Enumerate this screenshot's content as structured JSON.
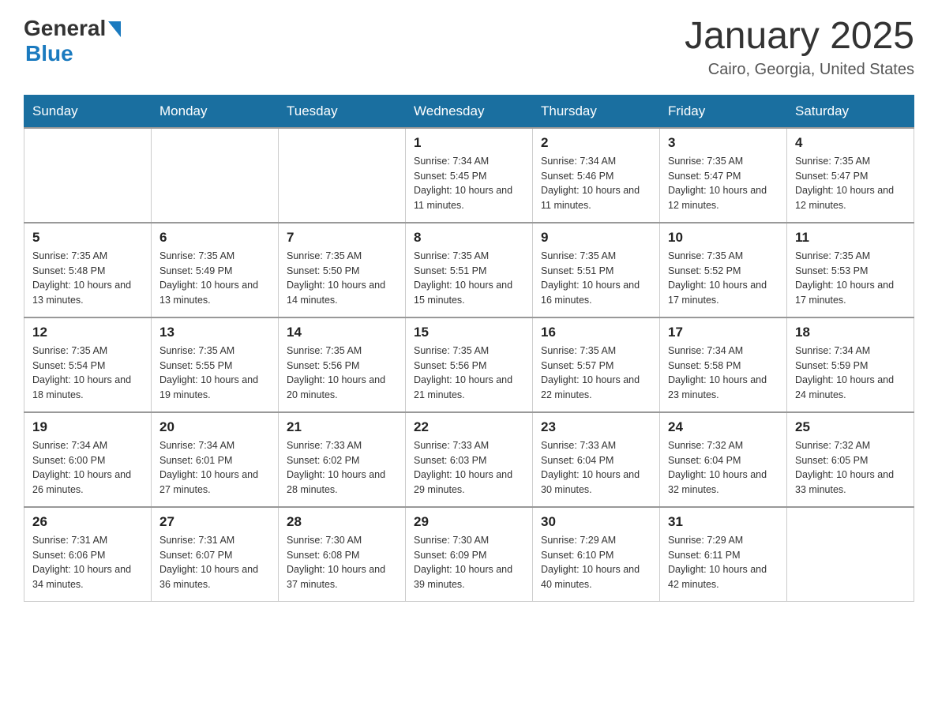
{
  "header": {
    "logo_general": "General",
    "logo_blue": "Blue",
    "month_title": "January 2025",
    "location": "Cairo, Georgia, United States"
  },
  "days_of_week": [
    "Sunday",
    "Monday",
    "Tuesday",
    "Wednesday",
    "Thursday",
    "Friday",
    "Saturday"
  ],
  "weeks": [
    [
      {
        "day": "",
        "sunrise": "",
        "sunset": "",
        "daylight": ""
      },
      {
        "day": "",
        "sunrise": "",
        "sunset": "",
        "daylight": ""
      },
      {
        "day": "",
        "sunrise": "",
        "sunset": "",
        "daylight": ""
      },
      {
        "day": "1",
        "sunrise": "Sunrise: 7:34 AM",
        "sunset": "Sunset: 5:45 PM",
        "daylight": "Daylight: 10 hours and 11 minutes."
      },
      {
        "day": "2",
        "sunrise": "Sunrise: 7:34 AM",
        "sunset": "Sunset: 5:46 PM",
        "daylight": "Daylight: 10 hours and 11 minutes."
      },
      {
        "day": "3",
        "sunrise": "Sunrise: 7:35 AM",
        "sunset": "Sunset: 5:47 PM",
        "daylight": "Daylight: 10 hours and 12 minutes."
      },
      {
        "day": "4",
        "sunrise": "Sunrise: 7:35 AM",
        "sunset": "Sunset: 5:47 PM",
        "daylight": "Daylight: 10 hours and 12 minutes."
      }
    ],
    [
      {
        "day": "5",
        "sunrise": "Sunrise: 7:35 AM",
        "sunset": "Sunset: 5:48 PM",
        "daylight": "Daylight: 10 hours and 13 minutes."
      },
      {
        "day": "6",
        "sunrise": "Sunrise: 7:35 AM",
        "sunset": "Sunset: 5:49 PM",
        "daylight": "Daylight: 10 hours and 13 minutes."
      },
      {
        "day": "7",
        "sunrise": "Sunrise: 7:35 AM",
        "sunset": "Sunset: 5:50 PM",
        "daylight": "Daylight: 10 hours and 14 minutes."
      },
      {
        "day": "8",
        "sunrise": "Sunrise: 7:35 AM",
        "sunset": "Sunset: 5:51 PM",
        "daylight": "Daylight: 10 hours and 15 minutes."
      },
      {
        "day": "9",
        "sunrise": "Sunrise: 7:35 AM",
        "sunset": "Sunset: 5:51 PM",
        "daylight": "Daylight: 10 hours and 16 minutes."
      },
      {
        "day": "10",
        "sunrise": "Sunrise: 7:35 AM",
        "sunset": "Sunset: 5:52 PM",
        "daylight": "Daylight: 10 hours and 17 minutes."
      },
      {
        "day": "11",
        "sunrise": "Sunrise: 7:35 AM",
        "sunset": "Sunset: 5:53 PM",
        "daylight": "Daylight: 10 hours and 17 minutes."
      }
    ],
    [
      {
        "day": "12",
        "sunrise": "Sunrise: 7:35 AM",
        "sunset": "Sunset: 5:54 PM",
        "daylight": "Daylight: 10 hours and 18 minutes."
      },
      {
        "day": "13",
        "sunrise": "Sunrise: 7:35 AM",
        "sunset": "Sunset: 5:55 PM",
        "daylight": "Daylight: 10 hours and 19 minutes."
      },
      {
        "day": "14",
        "sunrise": "Sunrise: 7:35 AM",
        "sunset": "Sunset: 5:56 PM",
        "daylight": "Daylight: 10 hours and 20 minutes."
      },
      {
        "day": "15",
        "sunrise": "Sunrise: 7:35 AM",
        "sunset": "Sunset: 5:56 PM",
        "daylight": "Daylight: 10 hours and 21 minutes."
      },
      {
        "day": "16",
        "sunrise": "Sunrise: 7:35 AM",
        "sunset": "Sunset: 5:57 PM",
        "daylight": "Daylight: 10 hours and 22 minutes."
      },
      {
        "day": "17",
        "sunrise": "Sunrise: 7:34 AM",
        "sunset": "Sunset: 5:58 PM",
        "daylight": "Daylight: 10 hours and 23 minutes."
      },
      {
        "day": "18",
        "sunrise": "Sunrise: 7:34 AM",
        "sunset": "Sunset: 5:59 PM",
        "daylight": "Daylight: 10 hours and 24 minutes."
      }
    ],
    [
      {
        "day": "19",
        "sunrise": "Sunrise: 7:34 AM",
        "sunset": "Sunset: 6:00 PM",
        "daylight": "Daylight: 10 hours and 26 minutes."
      },
      {
        "day": "20",
        "sunrise": "Sunrise: 7:34 AM",
        "sunset": "Sunset: 6:01 PM",
        "daylight": "Daylight: 10 hours and 27 minutes."
      },
      {
        "day": "21",
        "sunrise": "Sunrise: 7:33 AM",
        "sunset": "Sunset: 6:02 PM",
        "daylight": "Daylight: 10 hours and 28 minutes."
      },
      {
        "day": "22",
        "sunrise": "Sunrise: 7:33 AM",
        "sunset": "Sunset: 6:03 PM",
        "daylight": "Daylight: 10 hours and 29 minutes."
      },
      {
        "day": "23",
        "sunrise": "Sunrise: 7:33 AM",
        "sunset": "Sunset: 6:04 PM",
        "daylight": "Daylight: 10 hours and 30 minutes."
      },
      {
        "day": "24",
        "sunrise": "Sunrise: 7:32 AM",
        "sunset": "Sunset: 6:04 PM",
        "daylight": "Daylight: 10 hours and 32 minutes."
      },
      {
        "day": "25",
        "sunrise": "Sunrise: 7:32 AM",
        "sunset": "Sunset: 6:05 PM",
        "daylight": "Daylight: 10 hours and 33 minutes."
      }
    ],
    [
      {
        "day": "26",
        "sunrise": "Sunrise: 7:31 AM",
        "sunset": "Sunset: 6:06 PM",
        "daylight": "Daylight: 10 hours and 34 minutes."
      },
      {
        "day": "27",
        "sunrise": "Sunrise: 7:31 AM",
        "sunset": "Sunset: 6:07 PM",
        "daylight": "Daylight: 10 hours and 36 minutes."
      },
      {
        "day": "28",
        "sunrise": "Sunrise: 7:30 AM",
        "sunset": "Sunset: 6:08 PM",
        "daylight": "Daylight: 10 hours and 37 minutes."
      },
      {
        "day": "29",
        "sunrise": "Sunrise: 7:30 AM",
        "sunset": "Sunset: 6:09 PM",
        "daylight": "Daylight: 10 hours and 39 minutes."
      },
      {
        "day": "30",
        "sunrise": "Sunrise: 7:29 AM",
        "sunset": "Sunset: 6:10 PM",
        "daylight": "Daylight: 10 hours and 40 minutes."
      },
      {
        "day": "31",
        "sunrise": "Sunrise: 7:29 AM",
        "sunset": "Sunset: 6:11 PM",
        "daylight": "Daylight: 10 hours and 42 minutes."
      },
      {
        "day": "",
        "sunrise": "",
        "sunset": "",
        "daylight": ""
      }
    ]
  ]
}
